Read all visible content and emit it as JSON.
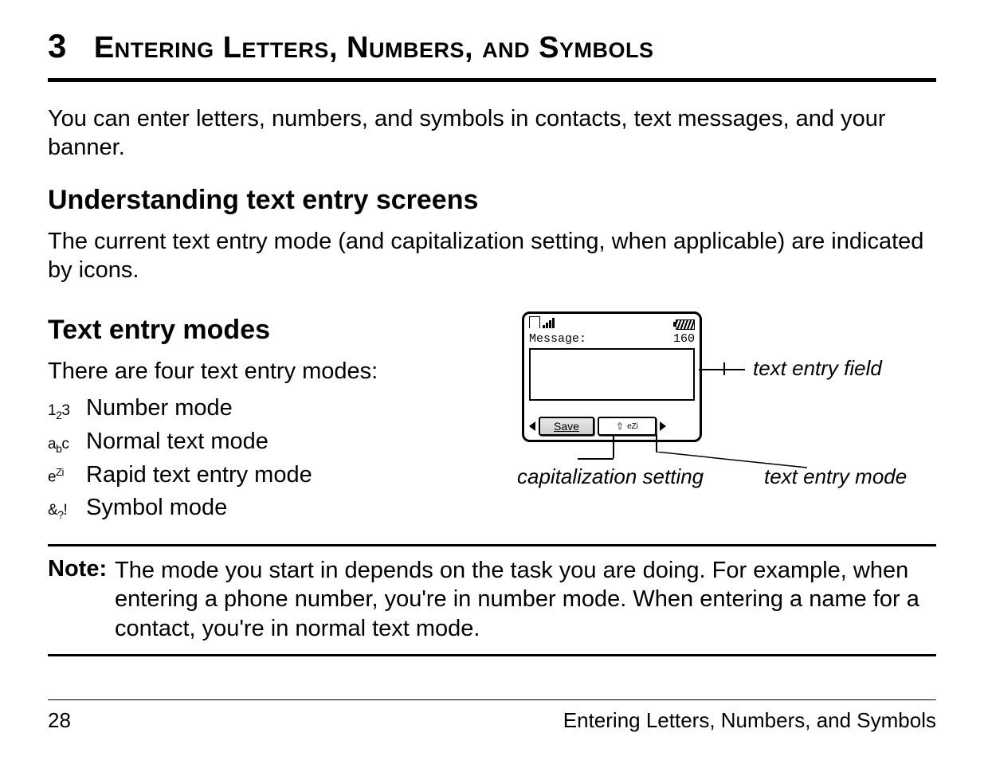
{
  "chapter": {
    "number": "3",
    "title": "Entering Letters, Numbers, and Symbols"
  },
  "intro": "You can enter letters, numbers, and symbols in contacts, text messages, and your banner.",
  "section1": {
    "heading": "Understanding text entry screens",
    "body": "The current text entry mode (and capitalization setting, when applicable) are indicated by icons."
  },
  "section2": {
    "heading": "Text entry modes",
    "intro": "There are four text entry modes:",
    "modes": [
      {
        "icon": "number-mode-icon",
        "glyph": "1₂3",
        "label": "Number mode"
      },
      {
        "icon": "normal-text-mode-icon",
        "glyph": "aᵇc",
        "label": "Normal text mode"
      },
      {
        "icon": "rapid-text-mode-icon",
        "glyph": "eZi",
        "label": "Rapid text entry mode"
      },
      {
        "icon": "symbol-mode-icon",
        "glyph": "&?!",
        "label": "Symbol mode"
      }
    ]
  },
  "illustration": {
    "message_label": "Message:",
    "char_count": "160",
    "softkey_save": "Save",
    "mode_indicator_cap": "⇧",
    "mode_indicator_ezi": "eZi",
    "callout_field": "text entry field",
    "callout_cap": "capitalization setting",
    "callout_mode": "text entry mode"
  },
  "note": {
    "label": "Note:",
    "text": "The mode you start in depends on the task you are doing. For example, when entering a phone number, you're in number mode. When entering a name for a contact, you're in normal text mode."
  },
  "footer": {
    "page_number": "28",
    "running_title": "Entering Letters, Numbers, and Symbols"
  }
}
